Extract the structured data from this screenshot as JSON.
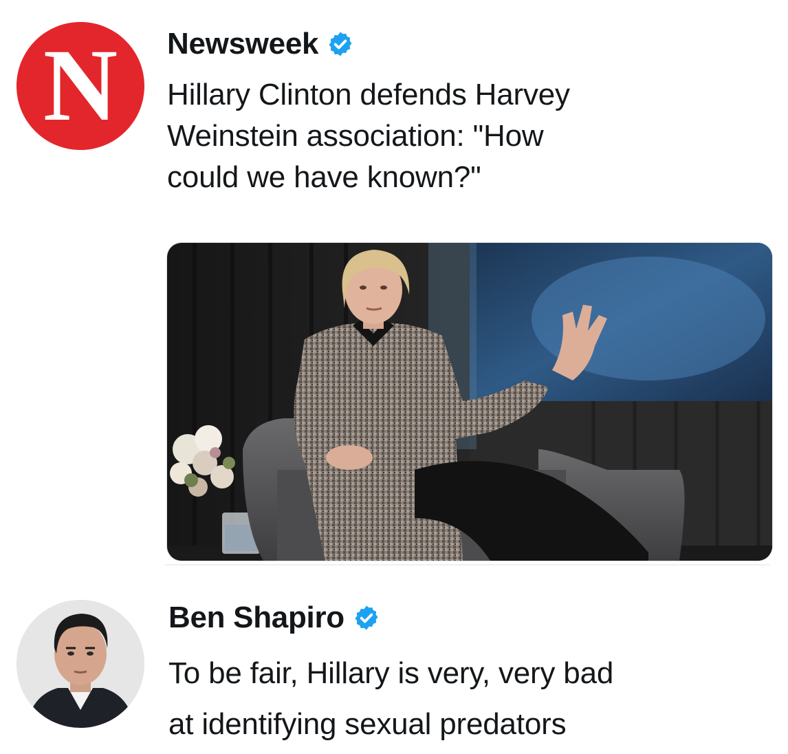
{
  "tweet1": {
    "avatar_letter": "N",
    "avatar_icon": "newsweek-logo",
    "author": "Newsweek",
    "verified_icon": "verified-badge-icon",
    "lines": [
      "Hillary Clinton defends Harvey",
      "Weinstein association: \"How",
      "could we have known?\""
    ],
    "photo_icon": "woman-in-armchair-photo"
  },
  "tweet2": {
    "avatar_icon": "man-portrait-avatar",
    "author": "Ben Shapiro",
    "verified_icon": "verified-badge-icon",
    "lines": [
      "To be fair, Hillary is very, very bad",
      "at identifying sexual predators"
    ]
  },
  "colors": {
    "newsweek_red": "#e3262b",
    "verified_blue": "#1da1f2",
    "text": "#14171a"
  }
}
